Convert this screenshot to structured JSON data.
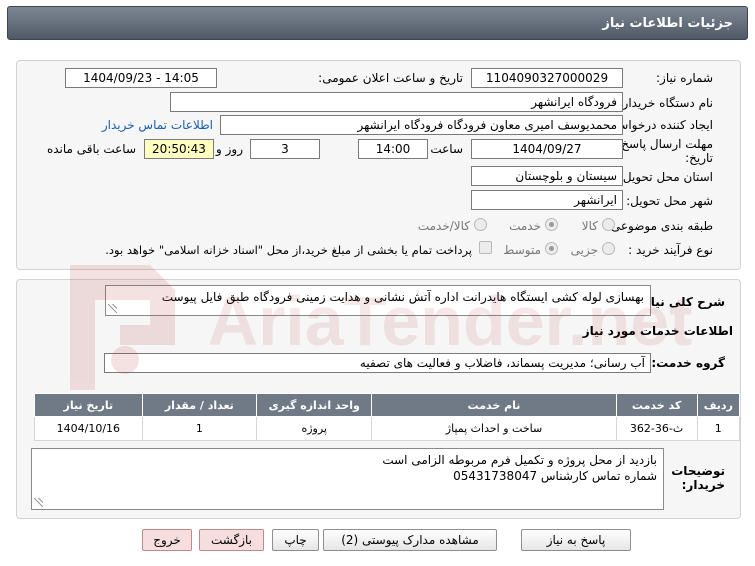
{
  "header": {
    "title": "جزئیات اطلاعات نیاز"
  },
  "fields": {
    "need_number": {
      "label": "شماره نیاز:",
      "value": "1104090327000029"
    },
    "announce_datetime": {
      "label": "تاریخ و ساعت اعلان عمومی:",
      "value": "1404/09/23 - 14:05"
    },
    "buyer_org": {
      "label": "نام دستگاه خریدار:",
      "value": "فرودگاه ایرانشهر"
    },
    "requester": {
      "label": "ایجاد کننده درخواست:",
      "value": "محمدیوسف امیری معاون فرودگاه فرودگاه ایرانشهر"
    },
    "buyer_contact_link": "اطلاعات تماس خریدار",
    "deadline": {
      "label_line1": "مهلت ارسال پاسخ: تا",
      "label_line2": "تاریخ:",
      "date": "1404/09/27",
      "time_label": "ساعت",
      "time": "14:00",
      "days": "3",
      "days_label": "روز و",
      "remaining": "20:50:43",
      "remaining_label": "ساعت باقی مانده"
    },
    "province": {
      "label": "استان محل تحویل:",
      "value": "سیستان و بلوچستان"
    },
    "city": {
      "label": "شهر محل تحویل:",
      "value": "ایرانشهر"
    },
    "category": {
      "label": "طبقه بندی موضوعی:",
      "options": [
        "کالا",
        "خدمت",
        "کالا/خدمت"
      ],
      "selected": "خدمت"
    },
    "process": {
      "label": "نوع فرآیند خرید :",
      "options": [
        "جزیی",
        "متوسط"
      ],
      "selected": "متوسط",
      "treasury_note": "پرداخت تمام یا بخشی از مبلغ خرید،از محل \"اسناد خزانه اسلامی\" خواهد بود."
    }
  },
  "summary": {
    "label": "شرح کلی نیاز:",
    "value": "بهسازی لوله کشی ایستگاه هایدرانت اداره آتش نشانی و هدایت زمینی فرودگاه طبق فایل پیوست"
  },
  "services_info": {
    "title": "اطلاعات خدمات مورد نیاز",
    "group_label": "گروه خدمت:",
    "group_value": "آب رسانی؛ مدیریت پسماند، فاضلاب و فعالیت های تصفیه"
  },
  "table": {
    "headers": [
      "ردیف",
      "کد خدمت",
      "نام خدمت",
      "واحد اندازه گیری",
      "تعداد / مقدار",
      "تاریخ نیاز"
    ],
    "rows": [
      [
        "1",
        "ث-36-362",
        "ساخت و احداث پمپاژ",
        "پروژه",
        "1",
        "1404/10/16"
      ]
    ]
  },
  "buyer_notes": {
    "label_line1": "توضیحات",
    "label_line2": "خریدار:",
    "line1": "بازدید از محل پروژه و تکمیل فرم مربوطه الزامی است",
    "line2": "شماره تماس کارشناس 05431738047"
  },
  "buttons": {
    "reply": "پاسخ به نیاز",
    "attachments": "مشاهده مدارک پیوستی (2)",
    "print": "چاپ",
    "back": "بازگشت",
    "exit": "خروج"
  },
  "watermark": {
    "text": "AriaTender.net"
  },
  "colors": {
    "header_bg": "#616b77",
    "table_header_bg": "#6f7a86",
    "link": "#1a5fb4",
    "remaining_bg": "#ffffc0",
    "exit_button_bg": "#f7dede"
  }
}
